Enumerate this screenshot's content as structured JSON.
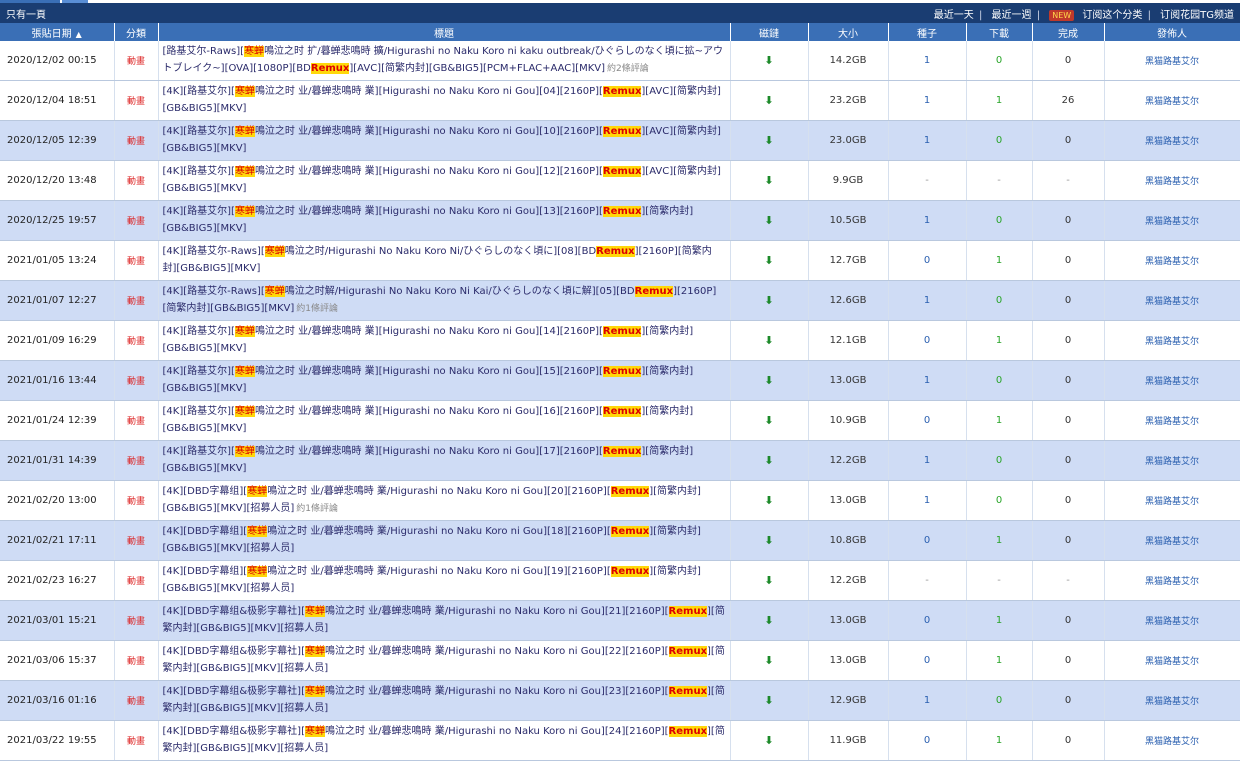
{
  "topbar": {
    "left": "只有一頁",
    "right": {
      "last_day": "最近一天",
      "last_week": "最近一週",
      "badge": "NEW",
      "subscribe_category": "订阅这个分类",
      "subscribe_tg": "订阅花园TG频道"
    }
  },
  "columns": [
    "張貼日期",
    "分類",
    "標題",
    "磁鏈",
    "大小",
    "種子",
    "下載",
    "完成",
    "發佈人"
  ],
  "sort_indicator": "▲",
  "magnet_glyph": "⬇",
  "rows": [
    {
      "date": "2020/12/02 00:15",
      "category": "動畫",
      "title_pre": "[路基艾尔-Raws][",
      "hl_a": "寒蝉",
      "title_mid": "鳴泣之时 扩/暮蝉悲鳴時 擴/Higurashi no Naku Koro ni kaku outbreak/ひぐらしのなく頃に拡~アウトブレイク~][OVA][1080P][BD",
      "hl_b": "Remux",
      "title_post": "][AVC][简繁内封][GB&BIG5][PCM+FLAC+AAC][MKV]",
      "comments": "約2條評論",
      "size": "14.2GB",
      "seeds": "1",
      "downloads": "0",
      "completed": "0",
      "publisher": "黑猫路基艾尔",
      "style": "light"
    },
    {
      "date": "2020/12/04 18:51",
      "category": "動畫",
      "title_pre": "[4K][路基艾尔][",
      "hl_a": "寒蝉",
      "title_mid": "鳴泣之时 业/暮蝉悲鳴時 業][Higurashi no Naku Koro ni Gou][04][2160P][",
      "hl_b": "Remux",
      "title_post": "][AVC][简繁内封][GB&BIG5][MKV]",
      "comments": "",
      "size": "23.2GB",
      "seeds": "1",
      "downloads": "1",
      "completed": "26",
      "publisher": "黑猫路基艾尔",
      "style": "light"
    },
    {
      "date": "2020/12/05 12:39",
      "category": "動畫",
      "title_pre": "[4K][路基艾尔][",
      "hl_a": "寒蝉",
      "title_mid": "鳴泣之时 业/暮蝉悲鳴時 業][Higurashi no Naku Koro ni Gou][10][2160P][",
      "hl_b": "Remux",
      "title_post": "][AVC][简繁内封][GB&BIG5][MKV]",
      "comments": "",
      "size": "23.0GB",
      "seeds": "1",
      "downloads": "0",
      "completed": "0",
      "publisher": "黑猫路基艾尔",
      "style": "blue"
    },
    {
      "date": "2020/12/20 13:48",
      "category": "動畫",
      "title_pre": "[4K][路基艾尔][",
      "hl_a": "寒蝉",
      "title_mid": "鳴泣之时 业/暮蝉悲鳴時 業][Higurashi no Naku Koro ni Gou][12][2160P][",
      "hl_b": "Remux",
      "title_post": "][AVC][简繁内封][GB&BIG5][MKV]",
      "comments": "",
      "size": "9.9GB",
      "seeds": "-",
      "downloads": "-",
      "completed": "-",
      "publisher": "黑猫路基艾尔",
      "style": "light"
    },
    {
      "date": "2020/12/25 19:57",
      "category": "動畫",
      "title_pre": "[4K][路基艾尔][",
      "hl_a": "寒蝉",
      "title_mid": "鳴泣之时 业/暮蝉悲鳴時 業][Higurashi no Naku Koro ni Gou][13][2160P][",
      "hl_b": "Remux",
      "title_post": "][简繁内封][GB&BIG5][MKV]",
      "comments": "",
      "size": "10.5GB",
      "seeds": "1",
      "downloads": "0",
      "completed": "0",
      "publisher": "黑猫路基艾尔",
      "style": "blue"
    },
    {
      "date": "2021/01/05 13:24",
      "category": "動畫",
      "title_pre": "[4K][路基艾尔-Raws][",
      "hl_a": "寒蝉",
      "title_mid": "鳴泣之时/Higurashi No Naku Koro Ni/ひぐらしのなく頃に][08][BD",
      "hl_b": "Remux",
      "title_post": "][2160P][简繁内封][GB&BIG5][MKV]",
      "comments": "",
      "size": "12.7GB",
      "seeds": "0",
      "downloads": "1",
      "completed": "0",
      "publisher": "黑猫路基艾尔",
      "style": "light"
    },
    {
      "date": "2021/01/07 12:27",
      "category": "動畫",
      "title_pre": "[4K][路基艾尔-Raws][",
      "hl_a": "寒蝉",
      "title_mid": "鳴泣之时解/Higurashi No Naku Koro Ni Kai/ひぐらしのなく頃に解][05][BD",
      "hl_b": "Remux",
      "title_post": "][2160P][简繁内封][GB&BIG5][MKV]",
      "comments": "約1條評論",
      "size": "12.6GB",
      "seeds": "1",
      "downloads": "0",
      "completed": "0",
      "publisher": "黑猫路基艾尔",
      "style": "blue"
    },
    {
      "date": "2021/01/09 16:29",
      "category": "動畫",
      "title_pre": "[4K][路基艾尔][",
      "hl_a": "寒蝉",
      "title_mid": "鳴泣之时 业/暮蝉悲鳴時 業][Higurashi no Naku Koro ni Gou][14][2160P][",
      "hl_b": "Remux",
      "title_post": "][简繁内封][GB&BIG5][MKV]",
      "comments": "",
      "size": "12.1GB",
      "seeds": "0",
      "downloads": "1",
      "completed": "0",
      "publisher": "黑猫路基艾尔",
      "style": "light"
    },
    {
      "date": "2021/01/16 13:44",
      "category": "動畫",
      "title_pre": "[4K][路基艾尔][",
      "hl_a": "寒蝉",
      "title_mid": "鳴泣之时 业/暮蝉悲鳴時 業][Higurashi no Naku Koro ni Gou][15][2160P][",
      "hl_b": "Remux",
      "title_post": "][简繁内封][GB&BIG5][MKV]",
      "comments": "",
      "size": "13.0GB",
      "seeds": "1",
      "downloads": "0",
      "completed": "0",
      "publisher": "黑猫路基艾尔",
      "style": "blue"
    },
    {
      "date": "2021/01/24 12:39",
      "category": "動畫",
      "title_pre": "[4K][路基艾尔][",
      "hl_a": "寒蝉",
      "title_mid": "鳴泣之时 业/暮蝉悲鳴時 業][Higurashi no Naku Koro ni Gou][16][2160P][",
      "hl_b": "Remux",
      "title_post": "][简繁内封][GB&BIG5][MKV]",
      "comments": "",
      "size": "10.9GB",
      "seeds": "0",
      "downloads": "1",
      "completed": "0",
      "publisher": "黑猫路基艾尔",
      "style": "light"
    },
    {
      "date": "2021/01/31 14:39",
      "category": "動畫",
      "title_pre": "[4K][路基艾尔][",
      "hl_a": "寒蝉",
      "title_mid": "鳴泣之时 业/暮蝉悲鳴時 業][Higurashi no Naku Koro ni Gou][17][2160P][",
      "hl_b": "Remux",
      "title_post": "][简繁内封][GB&BIG5][MKV]",
      "comments": "",
      "size": "12.2GB",
      "seeds": "1",
      "downloads": "0",
      "completed": "0",
      "publisher": "黑猫路基艾尔",
      "style": "blue"
    },
    {
      "date": "2021/02/20 13:00",
      "category": "動畫",
      "title_pre": "[4K][DBD字幕组][",
      "hl_a": "寒蝉",
      "title_mid": "鳴泣之时 业/暮蝉悲鳴時 業/Higurashi no Naku Koro ni Gou][20][2160P][",
      "hl_b": "Remux",
      "title_post": "][简繁内封][GB&BIG5][MKV][招募人员]",
      "comments": "約1條評論",
      "size": "13.0GB",
      "seeds": "1",
      "downloads": "0",
      "completed": "0",
      "publisher": "黑猫路基艾尔",
      "style": "light"
    },
    {
      "date": "2021/02/21 17:11",
      "category": "動畫",
      "title_pre": "[4K][DBD字幕组][",
      "hl_a": "寒蝉",
      "title_mid": "鳴泣之时 业/暮蝉悲鳴時 業/Higurashi no Naku Koro ni Gou][18][2160P][",
      "hl_b": "Remux",
      "title_post": "][简繁内封][GB&BIG5][MKV][招募人员]",
      "comments": "",
      "size": "10.8GB",
      "seeds": "0",
      "downloads": "1",
      "completed": "0",
      "publisher": "黑猫路基艾尔",
      "style": "blue"
    },
    {
      "date": "2021/02/23 16:27",
      "category": "動畫",
      "title_pre": "[4K][DBD字幕组][",
      "hl_a": "寒蝉",
      "title_mid": "鳴泣之时 业/暮蝉悲鳴時 業/Higurashi no Naku Koro ni Gou][19][2160P][",
      "hl_b": "Remux",
      "title_post": "][简繁内封][GB&BIG5][MKV][招募人员]",
      "comments": "",
      "size": "12.2GB",
      "seeds": "-",
      "downloads": "-",
      "completed": "-",
      "publisher": "黑猫路基艾尔",
      "style": "light"
    },
    {
      "date": "2021/03/01 15:21",
      "category": "動畫",
      "title_pre": "[4K][DBD字幕组&极影字幕社][",
      "hl_a": "寒蝉",
      "title_mid": "鳴泣之时 业/暮蝉悲鳴時 業/Higurashi no Naku Koro ni Gou][21][2160P][",
      "hl_b": "Remux",
      "title_post": "][简繁内封][GB&BIG5][MKV][招募人员]",
      "comments": "",
      "size": "13.0GB",
      "seeds": "0",
      "downloads": "1",
      "completed": "0",
      "publisher": "黑猫路基艾尔",
      "style": "blue"
    },
    {
      "date": "2021/03/06 15:37",
      "category": "動畫",
      "title_pre": "[4K][DBD字幕组&极影字幕社][",
      "hl_a": "寒蝉",
      "title_mid": "鳴泣之时 业/暮蝉悲鳴時 業/Higurashi no Naku Koro ni Gou][22][2160P][",
      "hl_b": "Remux",
      "title_post": "][简繁内封][GB&BIG5][MKV][招募人员]",
      "comments": "",
      "size": "13.0GB",
      "seeds": "0",
      "downloads": "1",
      "completed": "0",
      "publisher": "黑猫路基艾尔",
      "style": "light"
    },
    {
      "date": "2021/03/16 01:16",
      "category": "動畫",
      "title_pre": "[4K][DBD字幕组&极影字幕社][",
      "hl_a": "寒蝉",
      "title_mid": "鳴泣之时 业/暮蝉悲鳴時 業/Higurashi no Naku Koro ni Gou][23][2160P][",
      "hl_b": "Remux",
      "title_post": "][简繁内封][GB&BIG5][MKV][招募人员]",
      "comments": "",
      "size": "12.9GB",
      "seeds": "1",
      "downloads": "0",
      "completed": "0",
      "publisher": "黑猫路基艾尔",
      "style": "blue"
    },
    {
      "date": "2021/03/22 19:55",
      "category": "動畫",
      "title_pre": "[4K][DBD字幕组&极影字幕社][",
      "hl_a": "寒蝉",
      "title_mid": "鳴泣之时 业/暮蝉悲鳴時 業/Higurashi no Naku Koro ni Gou][24][2160P][",
      "hl_b": "Remux",
      "title_post": "][简繁内封][GB&BIG5][MKV][招募人员]",
      "comments": "",
      "size": "11.9GB",
      "seeds": "0",
      "downloads": "1",
      "completed": "0",
      "publisher": "黑猫路基艾尔",
      "style": "light"
    }
  ]
}
